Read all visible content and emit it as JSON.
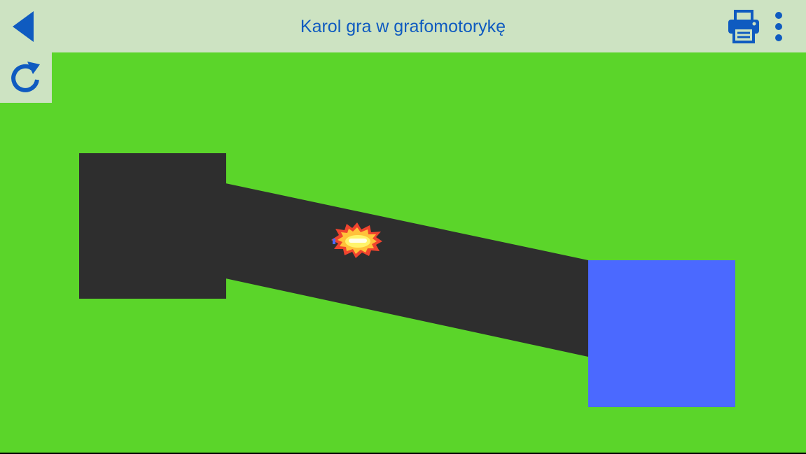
{
  "app": {
    "title": "Karol gra w grafomotorykę"
  },
  "toolbar": {
    "back_icon": "back-triangle-icon",
    "print_icon": "printer-icon",
    "more_icon": "more-vert-icon",
    "refresh_icon": "refresh-icon"
  },
  "colors": {
    "toolbar_bg": "#CDE3C2",
    "accent_blue": "#0F5BC0",
    "field_green": "#5BD52A",
    "path_dark": "#2E2E2E",
    "target_blue": "#4B69FF",
    "spark_red": "#F0442E",
    "spark_yellow": "#FFF46A"
  },
  "game": {
    "cursor_icon": "spark-burst-icon"
  }
}
